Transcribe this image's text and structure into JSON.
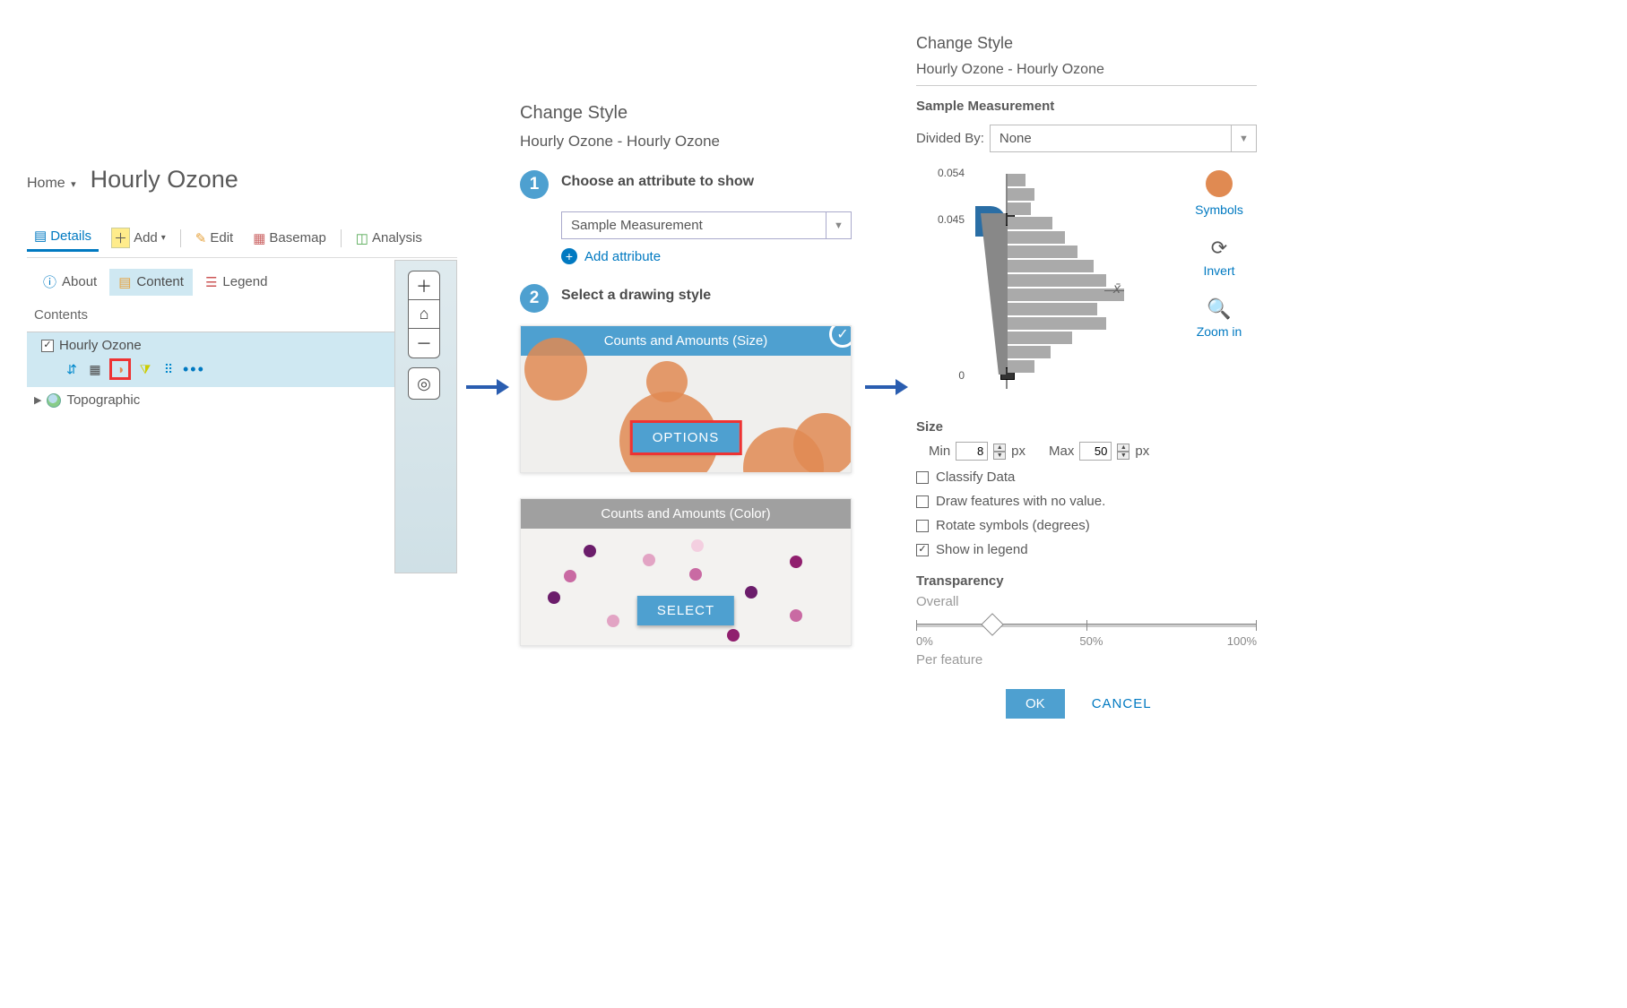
{
  "panel1": {
    "home": "Home",
    "title": "Hourly Ozone",
    "toolbar": {
      "details": "Details",
      "add": "Add",
      "edit": "Edit",
      "basemap": "Basemap",
      "analysis": "Analysis"
    },
    "subtabs": {
      "about": "About",
      "content": "Content",
      "legend": "Legend"
    },
    "contents": "Contents",
    "layer1": "Hourly Ozone",
    "layer2": "Topographic"
  },
  "panel2": {
    "title": "Change Style",
    "subtitle": "Hourly Ozone - Hourly Ozone",
    "step1num": "1",
    "step1": "Choose an attribute to show",
    "attrSelected": "Sample Measurement",
    "addAttr": "Add attribute",
    "step2num": "2",
    "step2": "Select a drawing style",
    "card1": "Counts and Amounts (Size)",
    "optionsBtn": "OPTIONS",
    "card2": "Counts and Amounts (Color)",
    "selectBtn": "SELECT"
  },
  "panel3": {
    "title": "Change Style",
    "subtitle": "Hourly Ozone - Hourly Ozone",
    "sample": "Sample Measurement",
    "dividedBy": "Divided By:",
    "dividedVal": "None",
    "tickTop": "0.054",
    "tickHi": "0.045",
    "tickLo": "0",
    "xbar": "x̄",
    "actions": {
      "symbols": "Symbols",
      "invert": "Invert",
      "zoom": "Zoom in"
    },
    "size": "Size",
    "min": "Min",
    "minVal": "8",
    "px": "px",
    "max": "Max",
    "maxVal": "50",
    "classify": "Classify Data",
    "noval": "Draw features with no value.",
    "rotate": "Rotate symbols (degrees)",
    "showleg": "Show in legend",
    "transparency": "Transparency",
    "overall": "Overall",
    "t0": "0%",
    "t50": "50%",
    "t100": "100%",
    "perfeature": "Per feature",
    "ok": "OK",
    "cancel": "CANCEL"
  }
}
